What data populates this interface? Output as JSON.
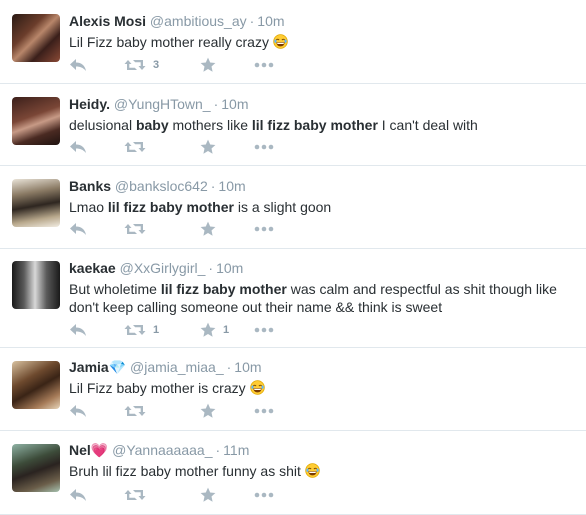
{
  "tweets": [
    {
      "name": "Alexis Mosi",
      "handle": "@ambitious_ay",
      "time": "10m",
      "parts": [
        {
          "t": "Lil Fizz baby mother really crazy "
        }
      ],
      "emoji": true,
      "retweets": "3",
      "favorites": ""
    },
    {
      "name": "Heidy.",
      "handle": "@YungHTown_",
      "time": "10m",
      "parts": [
        {
          "t": "delusional "
        },
        {
          "t": "baby",
          "b": true
        },
        {
          "t": " mothers like "
        },
        {
          "t": "lil fizz baby mother",
          "b": true
        },
        {
          "t": " I can't deal with"
        }
      ],
      "emoji": false,
      "retweets": "",
      "favorites": ""
    },
    {
      "name": "Banks",
      "handle": "@banksloc642",
      "time": "10m",
      "parts": [
        {
          "t": "Lmao "
        },
        {
          "t": "lil fizz baby mother",
          "b": true
        },
        {
          "t": " is a slight goon"
        }
      ],
      "emoji": false,
      "retweets": "",
      "favorites": ""
    },
    {
      "name": "kaekae",
      "handle": "@XxGirlygirl_",
      "time": "10m",
      "parts": [
        {
          "t": "But wholetime "
        },
        {
          "t": "lil fizz baby mother",
          "b": true
        },
        {
          "t": " was calm and respectful as shit though like"
        }
      ],
      "line2": "don't keep calling someone out their name && think is sweet",
      "emoji": false,
      "retweets": "1",
      "favorites": "1"
    },
    {
      "name": "Jamia💎",
      "handle": "@jamia_miaa_",
      "time": "10m",
      "parts": [
        {
          "t": "Lil Fizz baby mother is crazy "
        }
      ],
      "emoji": true,
      "retweets": "",
      "favorites": ""
    },
    {
      "name": "Nel💗",
      "handle": "@Yannaaaaaa_",
      "time": "11m",
      "parts": [
        {
          "t": "Bruh lil fizz baby mother funny as shit "
        }
      ],
      "emoji": true,
      "retweets": "",
      "favorites": ""
    }
  ],
  "colors": {
    "name": "#292f33",
    "meta": "#8899a6",
    "icon": "#aab8c2",
    "border": "#e1e8ed"
  }
}
